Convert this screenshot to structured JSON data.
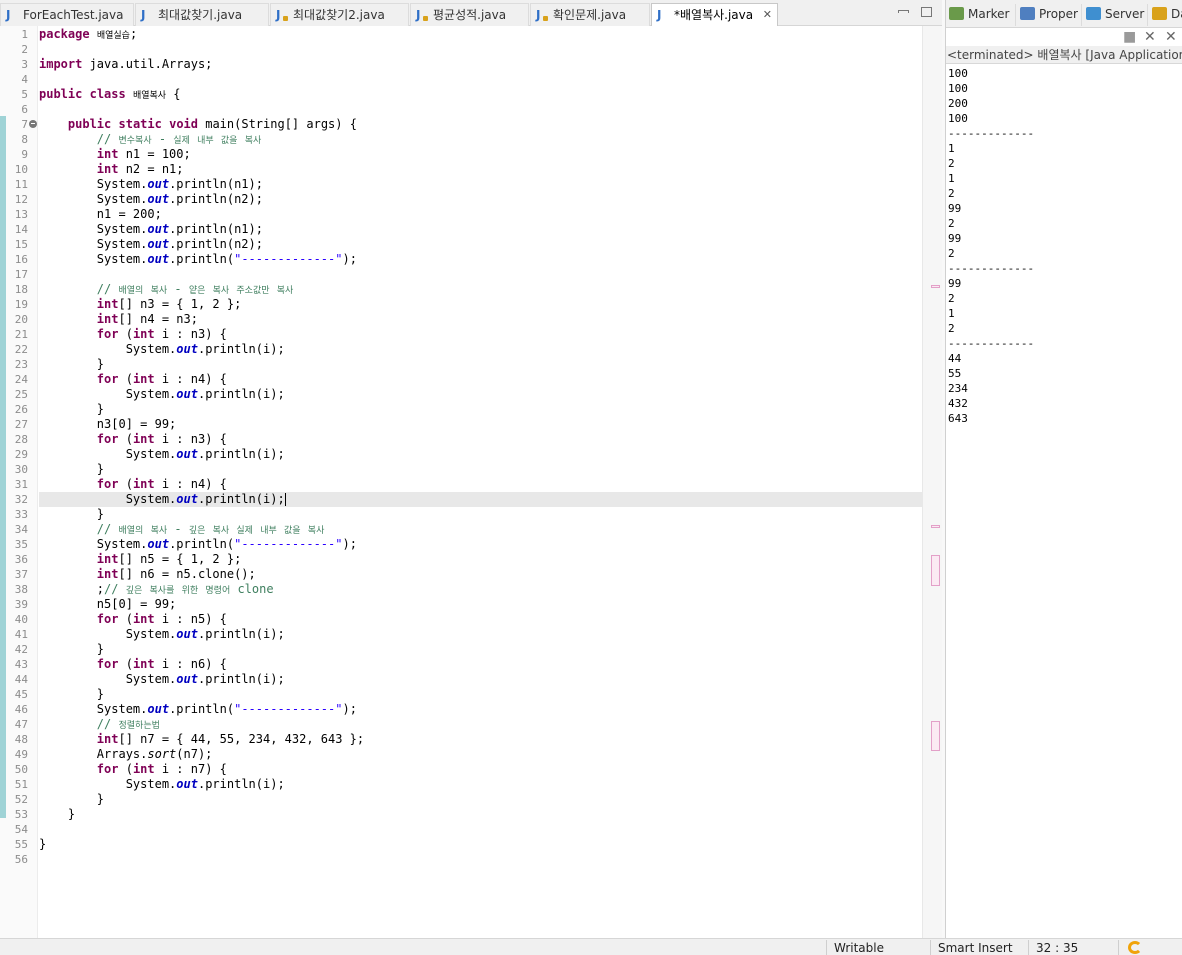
{
  "editor_tabs": [
    {
      "label": "ForEachTest.java",
      "icon": "java-file-icon",
      "active": false
    },
    {
      "label": "최대값찾기.java",
      "icon": "java-file-icon",
      "active": false
    },
    {
      "label": "최대값찾기2.java",
      "icon": "java-file-warning-icon",
      "active": false
    },
    {
      "label": "평균성적.java",
      "icon": "java-file-warning-icon",
      "active": false
    },
    {
      "label": "확인문제.java",
      "icon": "java-file-warning-icon",
      "active": false
    },
    {
      "label": "*배열복사.java",
      "icon": "java-file-icon",
      "active": true
    }
  ],
  "editor": {
    "close_glyph": "✕",
    "current_line": 32,
    "line_count": 56,
    "code_lines": [
      "package 배열실습;",
      "",
      "import java.util.Arrays;",
      "",
      "public class 배열복사 {",
      "",
      "    public static void main(String[] args) {",
      "        // 변수복사 - 실제 내부 값을 복사",
      "        int n1 = 100;",
      "        int n2 = n1;",
      "        System.out.println(n1);",
      "        System.out.println(n2);",
      "        n1 = 200;",
      "        System.out.println(n1);",
      "        System.out.println(n2);",
      "        System.out.println(\"-------------\");",
      "",
      "        // 배열의 복사 - 얕은 복사 주소값만 복사",
      "        int[] n3 = { 1, 2 };",
      "        int[] n4 = n3;",
      "        for (int i : n3) {",
      "            System.out.println(i);",
      "        }",
      "        for (int i : n4) {",
      "            System.out.println(i);",
      "        }",
      "        n3[0] = 99;",
      "        for (int i : n3) {",
      "            System.out.println(i);",
      "        }",
      "        for (int i : n4) {",
      "            System.out.println(i);",
      "        }",
      "        // 배열의 복사 - 깊은 복사 실제 내부 값을 복사",
      "        System.out.println(\"-------------\");",
      "        int[] n5 = { 1, 2 };",
      "        int[] n6 = n5.clone();",
      "        ;// 깊은 복사를 위한 명령어 clone",
      "        n5[0] = 99;",
      "        for (int i : n5) {",
      "            System.out.println(i);",
      "        }",
      "        for (int i : n6) {",
      "            System.out.println(i);",
      "        }",
      "        System.out.println(\"-------------\");",
      "        // 정렬하는법",
      "        int[] n7 = { 44, 55, 234, 432, 643 };",
      "        Arrays.sort(n7);",
      "        for (int i : n7) {",
      "            System.out.println(i);",
      "        }",
      "    }",
      "",
      "}",
      ""
    ]
  },
  "view_tabs": [
    {
      "label": "Marker",
      "icon": "markers-icon"
    },
    {
      "label": "Proper",
      "icon": "properties-icon"
    },
    {
      "label": "Server",
      "icon": "servers-icon"
    },
    {
      "label": "Da",
      "icon": "data-source-icon"
    }
  ],
  "console": {
    "header": "<terminated> 배열복사 [Java Application] C",
    "stop_glyph": "■",
    "remove_glyph": "✕",
    "remove_all_glyph": "✕",
    "output": [
      "100",
      "100",
      "200",
      "100",
      "-------------",
      "1",
      "2",
      "1",
      "2",
      "99",
      "2",
      "99",
      "2",
      "-------------",
      "99",
      "2",
      "1",
      "2",
      "-------------",
      "44",
      "55",
      "234",
      "432",
      "643"
    ]
  },
  "status_bar": {
    "mode": "Writable",
    "insert_mode": "Smart Insert",
    "position": "32 : 35"
  },
  "colors": {
    "keyword": "#7f0055",
    "static_field": "#0000c0",
    "string": "#2a00ff",
    "comment": "#3f7f5f",
    "current_line": "#e8e8e8",
    "change_marker": "#9fd3d6"
  }
}
